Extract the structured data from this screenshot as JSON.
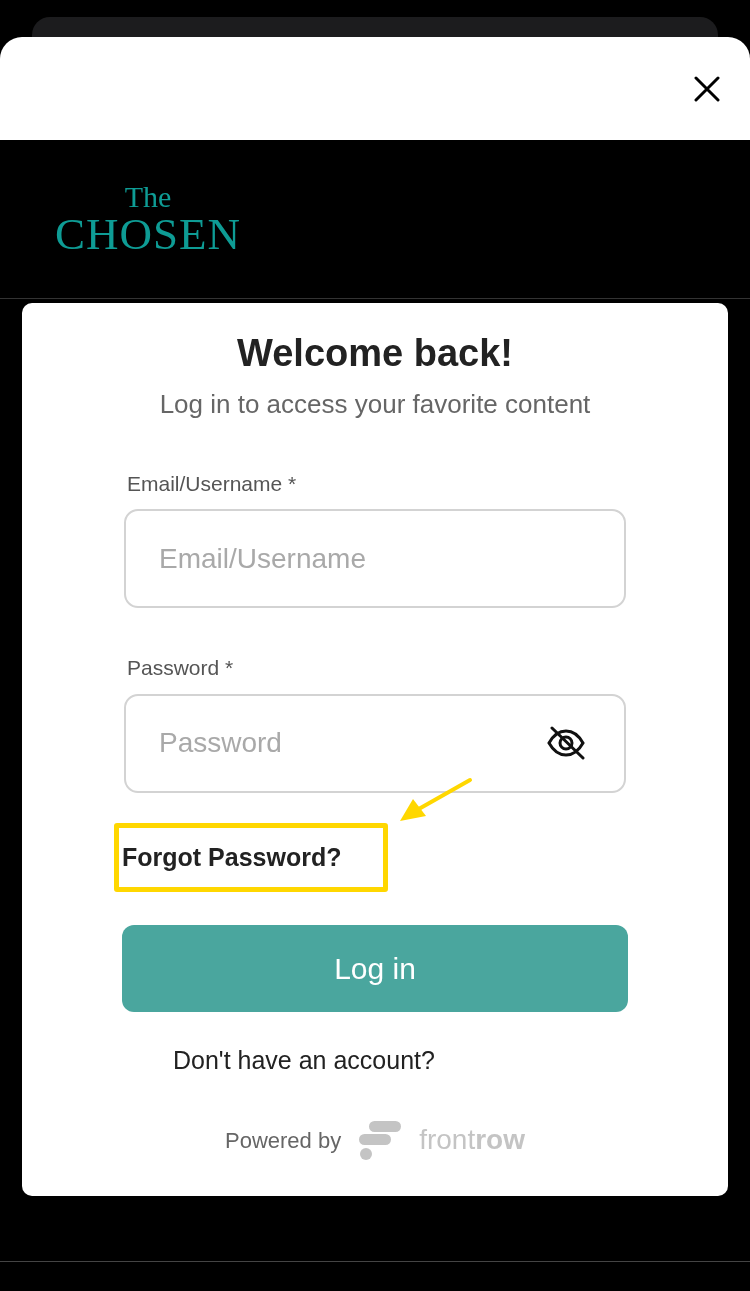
{
  "logo": {
    "line_1": "The",
    "line_2": "CHOSEN"
  },
  "login": {
    "title": "Welcome back!",
    "subtitle": "Log in to access your favorite content",
    "fields": [
      {
        "label": "Email/Username *",
        "placeholder": "Email/Username",
        "kind": "text"
      },
      {
        "label": "Password *",
        "placeholder": "Password",
        "kind": "password",
        "password_visible": false
      }
    ],
    "forgot_link": {
      "text": "Forgot Password?",
      "highlighted": true
    },
    "submit_button": "Log in",
    "signup_prompt": "Don't have an account?",
    "powered_by": {
      "text": "Powered by",
      "brand": "front**row**"
    }
  }
}
